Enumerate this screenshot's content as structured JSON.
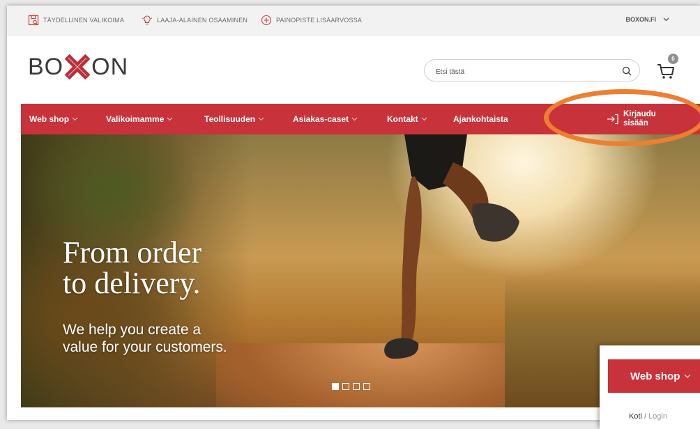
{
  "utility_bar": {
    "items": [
      {
        "label": "TÄYDELLINEN VALIKOIMA",
        "icon": "package-icon"
      },
      {
        "label": "LAAJA-ALAINEN OSAAMINEN",
        "icon": "lightbulb-icon"
      },
      {
        "label": "PAINOPISTE LISÄARVOSSA",
        "icon": "plus-circle-icon"
      }
    ],
    "region": "BOXON.FI"
  },
  "header": {
    "logo_left": "BO",
    "logo_right": "ON",
    "search_placeholder": "Etsi tästä",
    "cart_count": "0"
  },
  "nav": {
    "items": [
      {
        "label": "Web shop",
        "has_dropdown": true
      },
      {
        "label": "Valikoimamme",
        "has_dropdown": true
      },
      {
        "label": "Teollisuuden",
        "has_dropdown": true
      },
      {
        "label": "Asiakas-caset",
        "has_dropdown": true
      },
      {
        "label": "Kontakt",
        "has_dropdown": true
      },
      {
        "label": "Ajankohtaista",
        "has_dropdown": false
      }
    ],
    "login_line1": "Kirjaudu",
    "login_line2": "sisään"
  },
  "hero": {
    "title": "From order\nto delivery.",
    "subtitle": "We help you create a\nvalue for your customers.",
    "slides_total": 4,
    "active_slide": 1
  },
  "popup": {
    "nav_label": "Web shop",
    "breadcrumb_home": "Koti",
    "breadcrumb_current": "Login"
  },
  "colors": {
    "brand_red": "#c8323a",
    "highlight_orange": "#ec7f31"
  }
}
